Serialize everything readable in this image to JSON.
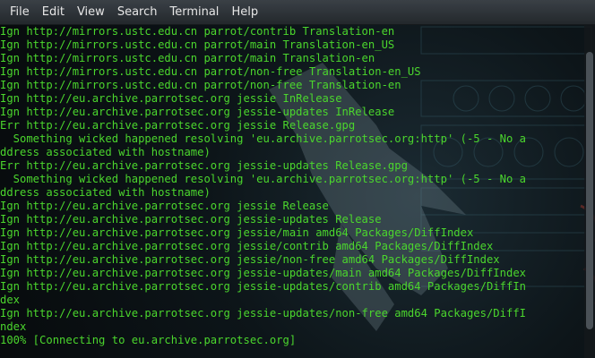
{
  "menubar": {
    "items": [
      "File",
      "Edit",
      "View",
      "Search",
      "Terminal",
      "Help"
    ]
  },
  "terminal": {
    "lines": [
      "Ign http://mirrors.ustc.edu.cn parrot/contrib Translation-en",
      "Ign http://mirrors.ustc.edu.cn parrot/main Translation-en_US",
      "Ign http://mirrors.ustc.edu.cn parrot/main Translation-en",
      "Ign http://mirrors.ustc.edu.cn parrot/non-free Translation-en_US",
      "Ign http://mirrors.ustc.edu.cn parrot/non-free Translation-en",
      "Ign http://eu.archive.parrotsec.org jessie InRelease",
      "Ign http://eu.archive.parrotsec.org jessie-updates InRelease",
      "Err http://eu.archive.parrotsec.org jessie Release.gpg",
      "  Something wicked happened resolving 'eu.archive.parrotsec.org:http' (-5 - No a",
      "ddress associated with hostname)",
      "Err http://eu.archive.parrotsec.org jessie-updates Release.gpg",
      "  Something wicked happened resolving 'eu.archive.parrotsec.org:http' (-5 - No a",
      "ddress associated with hostname)",
      "Ign http://eu.archive.parrotsec.org jessie Release",
      "Ign http://eu.archive.parrotsec.org jessie-updates Release",
      "Ign http://eu.archive.parrotsec.org jessie/main amd64 Packages/DiffIndex",
      "Ign http://eu.archive.parrotsec.org jessie/contrib amd64 Packages/DiffIndex",
      "Ign http://eu.archive.parrotsec.org jessie/non-free amd64 Packages/DiffIndex",
      "Ign http://eu.archive.parrotsec.org jessie-updates/main amd64 Packages/DiffIndex",
      "Ign http://eu.archive.parrotsec.org jessie-updates/contrib amd64 Packages/DiffIn",
      "dex",
      "Ign http://eu.archive.parrotsec.org jessie-updates/non-free amd64 Packages/DiffI",
      "ndex",
      "100% [Connecting to eu.archive.parrotsec.org]"
    ]
  },
  "colors": {
    "terminal_text": "#4bd62d",
    "menubar_text": "#e6e6e6"
  }
}
